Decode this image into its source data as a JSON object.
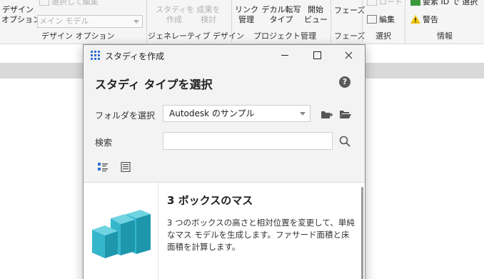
{
  "ribbon": {
    "design_options": {
      "button_line1": "デザイン",
      "button_line2": "オプション",
      "select_label": "選択して編集",
      "combo_value": "メイン モデル",
      "group_label": "デザイン オプション"
    },
    "generative": {
      "create_study_line1": "スタディを",
      "create_study_line2": "作成",
      "explore_line1": "成果を",
      "explore_line2": "検討",
      "group_label": "ジェネレーティブ デザイン"
    },
    "project": {
      "link_line1": "リンク",
      "link_line2": "管理",
      "decal_line1": "デカル転写",
      "decal_line2": "タイプ",
      "start_line1": "開始",
      "start_line2": "ビュー",
      "group_label": "プロジェクト管理"
    },
    "phases": {
      "button": "フェーズ",
      "group_label": "フェーズ"
    },
    "selection": {
      "load": "ロード",
      "edit": "編集",
      "group_label": "選択"
    },
    "info": {
      "select_by_id": "要素 ID で 選択",
      "warnings": "警告",
      "group_label": "情報"
    }
  },
  "dialog": {
    "title": "スタディを作成",
    "heading": "スタディ タイプを選択",
    "help": "?",
    "folder_label": "フォルダを選択",
    "folder_value": "Autodesk のサンプル",
    "search_label": "検索",
    "search_value": "",
    "search_placeholder": "",
    "result": {
      "title": "3 ボックスのマス",
      "description": "3 つのボックスの高さと相対位置を変更して、単純なマス モデルを生成します。ファサード面積と床面積を計算します。"
    }
  },
  "colors": {
    "accent": "#2f6fd6",
    "thumb_cyan": "#2fb3c9",
    "disabled_text": "#b3b3b3"
  }
}
